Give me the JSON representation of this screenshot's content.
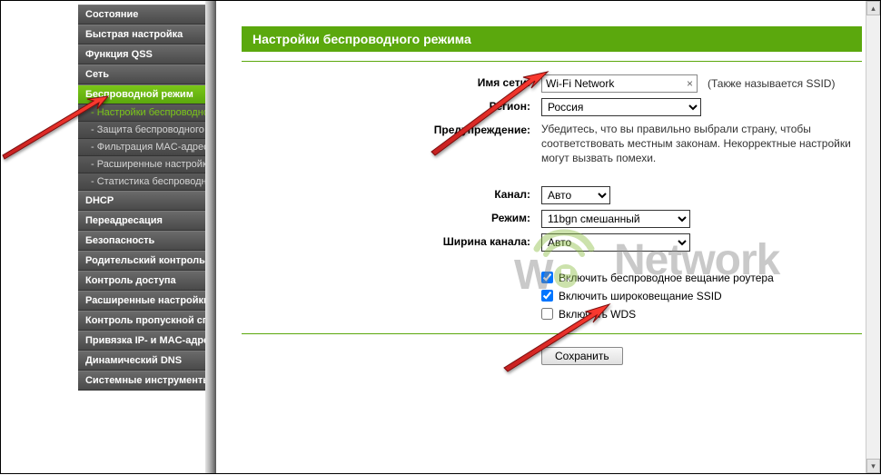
{
  "menu": {
    "items": [
      {
        "label": "Состояние"
      },
      {
        "label": "Быстрая настройка"
      },
      {
        "label": "Функция QSS"
      },
      {
        "label": "Сеть"
      },
      {
        "label": "Беспроводной режим",
        "active": true
      },
      {
        "label": "DHCP"
      },
      {
        "label": "Переадресация"
      },
      {
        "label": "Безопасность"
      },
      {
        "label": "Родительский контроль"
      },
      {
        "label": "Контроль доступа"
      },
      {
        "label": "Расширенные настройки маршрутизации"
      },
      {
        "label": "Контроль пропускной способности"
      },
      {
        "label": "Привязка IP- и MAC-адресов"
      },
      {
        "label": "Динамический DNS"
      },
      {
        "label": "Системные инструменты"
      }
    ],
    "submenu": [
      {
        "label": "- Настройки беспроводного режима",
        "active": true
      },
      {
        "label": "- Защита беспроводного режима"
      },
      {
        "label": "- Фильтрация MAC-адресов"
      },
      {
        "label": "- Расширенные настройки"
      },
      {
        "label": "- Статистика беспроводного режима"
      }
    ]
  },
  "panel": {
    "title": "Настройки беспроводного режима",
    "labels": {
      "ssid": "Имя сети:",
      "region": "Регион:",
      "warning": "Предупреждение:",
      "channel": "Канал:",
      "mode": "Режим:",
      "width": "Ширина канала:"
    },
    "values": {
      "ssid": "Wi-Fi Network",
      "region": "Россия",
      "channel": "Авто",
      "mode": "11bgn смешанный",
      "width": "Авто"
    },
    "ssid_hint": "(Также называется SSID)",
    "warning_text": "Убедитесь, что вы правильно выбрали страну, чтобы соответствовать местным законам. Некорректные настройки могут вызвать помехи.",
    "checkboxes": {
      "broadcast_router": "Включить беспроводное вещание роутера",
      "broadcast_ssid": "Включить широковещание SSID",
      "wds": "Включить WDS"
    },
    "save": "Сохранить"
  },
  "watermark": "Network"
}
